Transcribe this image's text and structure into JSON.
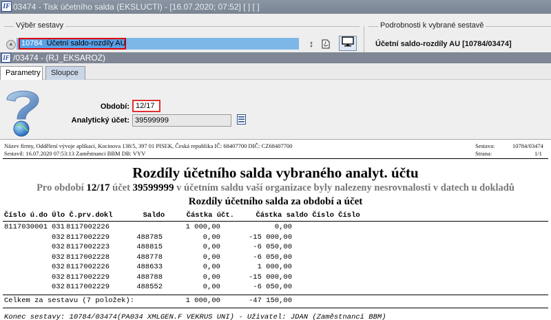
{
  "window": {
    "title": "03474 - Tisk účetního salda (EKSLUCTI) - [16.07.2020; 07:52]  [ ]  [ ]",
    "app_icon_text": "IF"
  },
  "top_panel": {
    "left_label": "Výběr sestavy",
    "right_label": "Podrobnosti k vybrané sestavě",
    "selected_code": "10784",
    "selected_name": "Účetní saldo-rozdíly AU",
    "detail_text": "Účetní saldo-rozdíly AU [10784/03474]",
    "icons": [
      "scroll-up-icon",
      "sort-icon",
      "pdf-icon",
      "monitor-icon"
    ]
  },
  "subtitle": "/03474 - (RJ_EKSAROZ)",
  "tabs": [
    {
      "label": "Parametry",
      "active": true
    },
    {
      "label": "Sloupce",
      "active": false
    }
  ],
  "params": {
    "obdobi_label": "Období:",
    "obdobi_value": "12/17",
    "ucet_label": "Analytický účet:",
    "ucet_value": "39599999"
  },
  "report": {
    "firm": "Název firmy, Oddělení vývoje aplikací, Kocinova 138/5, 397 01 PISEK, Česká republika  IČ: 68407700  DIČ: CZ68407700",
    "created": "Sestavil: 16.07.2020 07:53:13 Zaměstnanci BBM  DB: VYV",
    "sestava_label": "Sestava:",
    "sestava_value": "10784/03474",
    "strana_label": "Strana:",
    "strana_value": "1/1",
    "title": "Rozdíly účetního salda vybraného analyt. účtu",
    "desc_1": "Pro období ",
    "desc_period": "12/17",
    "desc_2": " účet ",
    "desc_account": "39599999",
    "desc_3": " v účetním saldu vaší organizace byly nalezeny nesrovnalosti v datech u dokladů",
    "subtitle": "Rozdíly účetního salda za období a účet",
    "header": "Číslo ú.do Úlo Č.prv.dokl       Saldo     Částka účt.     Částka saldo Číslo Číslo",
    "rows": [
      {
        "cislo": "8117030001",
        "ulo": "031",
        "doklad": "8117002226",
        "saldo": "",
        "castka": "1 000,00",
        "csaldo": "0,00"
      },
      {
        "cislo": "",
        "ulo": "032",
        "doklad": "8117002229",
        "saldo": "488785",
        "castka": "0,00",
        "csaldo": "-15 000,00"
      },
      {
        "cislo": "",
        "ulo": "032",
        "doklad": "8117002223",
        "saldo": "488815",
        "castka": "0,00",
        "csaldo": "-6 050,00"
      },
      {
        "cislo": "",
        "ulo": "032",
        "doklad": "8117002228",
        "saldo": "488778",
        "castka": "0,00",
        "csaldo": "-6 050,00"
      },
      {
        "cislo": "",
        "ulo": "032",
        "doklad": "8117002226",
        "saldo": "488633",
        "castka": "0,00",
        "csaldo": "1 000,00"
      },
      {
        "cislo": "",
        "ulo": "032",
        "doklad": "8117002229",
        "saldo": "488788",
        "castka": "0,00",
        "csaldo": "-15 000,00"
      },
      {
        "cislo": "",
        "ulo": "032",
        "doklad": "8117002229",
        "saldo": "488552",
        "castka": "0,00",
        "csaldo": "-6 050,00"
      }
    ],
    "total_label": "Celkem za sestavu (7 položek):",
    "total_castka": "1 000,00",
    "total_csaldo": "-47 150,00",
    "footer": "Konec sestavy: 10784/03474(PA034 XMLGEN.F VEKRUS UNI) - Uživatel: JDAN (Zaměstnanci BBM)"
  }
}
